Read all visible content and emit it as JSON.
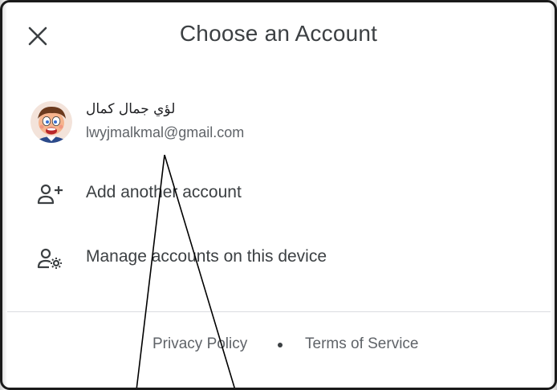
{
  "dialog": {
    "title": "Choose an Account"
  },
  "icons": {
    "close": "close-icon",
    "add_account": "person-add-icon",
    "manage_accounts": "manage-accounts-icon"
  },
  "account": {
    "name": "لؤي جمال كمال",
    "email": "lwyjmalkmal@gmail.com",
    "avatar": "cartoon-boy-avatar"
  },
  "options": {
    "add_account": "Add another account",
    "manage_accounts": "Manage accounts on this device"
  },
  "footer": {
    "privacy": "Privacy Policy",
    "separator": "•",
    "terms": "Terms of Service"
  },
  "colors": {
    "title_text": "#3c4043",
    "secondary_text": "#5f6368",
    "divider": "#dadce0",
    "background": "#ffffff"
  }
}
